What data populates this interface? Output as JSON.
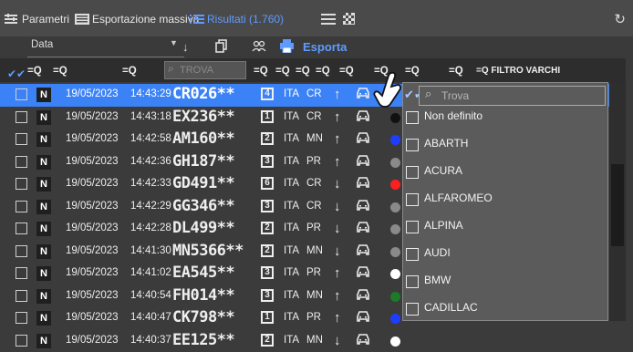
{
  "toolbar": {
    "tabs": [
      {
        "label": "Parametri"
      },
      {
        "label": "Esportazione massiva"
      },
      {
        "label": "Risultati (1.760)"
      }
    ],
    "data_label": "Data",
    "esporta_label": "Esporta",
    "accent_color": "#5f9bff"
  },
  "filters": {
    "filter_icon_label": "=Q",
    "trova_placeholder": "TROVA",
    "filtro_varchi": "=Q FILTRO VARCHI"
  },
  "rows": [
    {
      "n": "N",
      "date": "19/05/2023",
      "time": "14:43:29",
      "plate": "CR026**",
      "lane": "4",
      "country": "ITA",
      "prov": "CR",
      "dir": "up",
      "selected": true,
      "dot": ""
    },
    {
      "n": "N",
      "date": "19/05/2023",
      "time": "14:43:18",
      "plate": "EX236**",
      "lane": "1",
      "country": "ITA",
      "prov": "CR",
      "dir": "up",
      "dot": "#111111"
    },
    {
      "n": "N",
      "date": "19/05/2023",
      "time": "14:42:58",
      "plate": "AM160**",
      "lane": "2",
      "country": "ITA",
      "prov": "MN",
      "dir": "up",
      "dot": "#1f3dff"
    },
    {
      "n": "N",
      "date": "19/05/2023",
      "time": "14:42:36",
      "plate": "GH187**",
      "lane": "3",
      "country": "ITA",
      "prov": "PR",
      "dir": "up",
      "dot": "#8a8a8a"
    },
    {
      "n": "N",
      "date": "19/05/2023",
      "time": "14:42:33",
      "plate": "GD491**",
      "lane": "6",
      "country": "ITA",
      "prov": "CR",
      "dir": "down",
      "dot": "#ff1f1f"
    },
    {
      "n": "N",
      "date": "19/05/2023",
      "time": "14:42:29",
      "plate": "GG346**",
      "lane": "3",
      "country": "ITA",
      "prov": "CR",
      "dir": "down",
      "dot": "#8a8a8a"
    },
    {
      "n": "N",
      "date": "19/05/2023",
      "time": "14:42:28",
      "plate": "DL499**",
      "lane": "2",
      "country": "ITA",
      "prov": "PR",
      "dir": "down",
      "dot": "#8a8a8a"
    },
    {
      "n": "N",
      "date": "19/05/2023",
      "time": "14:41:30",
      "plate": "MN5366**",
      "lane": "2",
      "country": "ITA",
      "prov": "MN",
      "dir": "down",
      "dot": "#8a8a8a"
    },
    {
      "n": "N",
      "date": "19/05/2023",
      "time": "14:41:02",
      "plate": "EA545**",
      "lane": "3",
      "country": "ITA",
      "prov": "PR",
      "dir": "up",
      "dot": "#ffffff"
    },
    {
      "n": "N",
      "date": "19/05/2023",
      "time": "14:40:54",
      "plate": "FH014**",
      "lane": "3",
      "country": "ITA",
      "prov": "MN",
      "dir": "up",
      "dot": "#1c7a2a"
    },
    {
      "n": "N",
      "date": "19/05/2023",
      "time": "14:40:47",
      "plate": "CK798**",
      "lane": "1",
      "country": "ITA",
      "prov": "PR",
      "dir": "up",
      "dot": "#1f3dff"
    },
    {
      "n": "N",
      "date": "19/05/2023",
      "time": "14:40:37",
      "plate": "EE125**",
      "lane": "2",
      "country": "ITA",
      "prov": "MN",
      "dir": "down",
      "dot": "#ffffff"
    }
  ],
  "dropdown": {
    "search_placeholder": "Trova",
    "options": [
      "Non definito",
      "ABARTH",
      "ACURA",
      "ALFAROMEO",
      "ALPINA",
      "AUDI",
      "BMW",
      "CADILLAC"
    ]
  }
}
